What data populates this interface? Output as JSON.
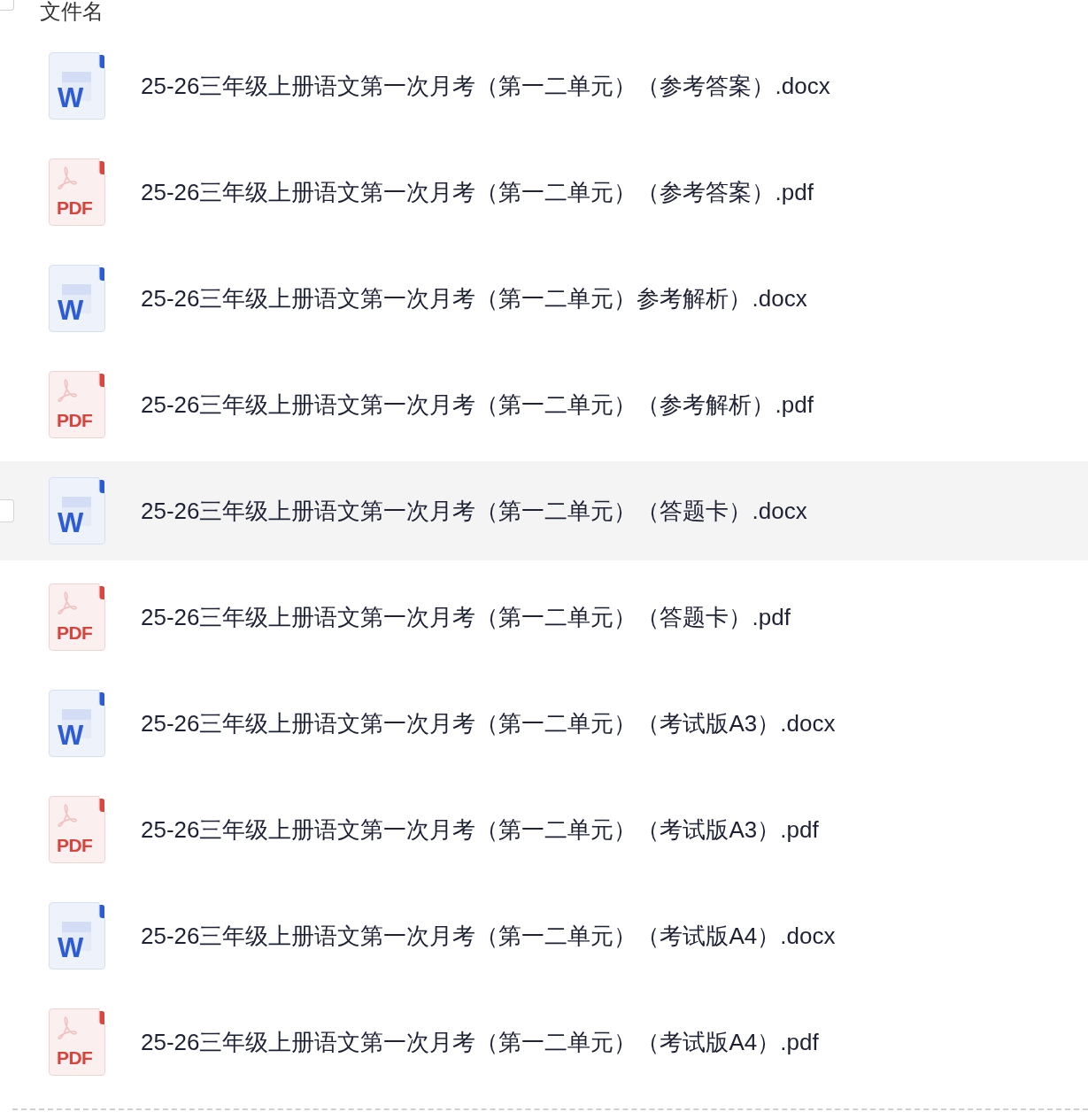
{
  "header": {
    "checkbox": {
      "checked": false
    },
    "label": "文件名"
  },
  "files": [
    {
      "kind": "docx",
      "type_label": "W",
      "name": "25-26三年级上册语文第一次月考（第一二单元）（参考答案）.docx",
      "highlighted": false,
      "checked": false
    },
    {
      "kind": "pdf",
      "type_label": "PDF",
      "name": "25-26三年级上册语文第一次月考（第一二单元）（参考答案）.pdf",
      "highlighted": false,
      "checked": false
    },
    {
      "kind": "docx",
      "type_label": "W",
      "name": "25-26三年级上册语文第一次月考（第一二单元）参考解析）.docx",
      "highlighted": false,
      "checked": false
    },
    {
      "kind": "pdf",
      "type_label": "PDF",
      "name": "25-26三年级上册语文第一次月考（第一二单元）（参考解析）.pdf",
      "highlighted": false,
      "checked": false
    },
    {
      "kind": "docx",
      "type_label": "W",
      "name": "25-26三年级上册语文第一次月考（第一二单元）（答题卡）.docx",
      "highlighted": true,
      "checked": false
    },
    {
      "kind": "pdf",
      "type_label": "PDF",
      "name": "25-26三年级上册语文第一次月考（第一二单元）（答题卡）.pdf",
      "highlighted": false,
      "checked": false
    },
    {
      "kind": "docx",
      "type_label": "W",
      "name": "25-26三年级上册语文第一次月考（第一二单元）（考试版A3）.docx",
      "highlighted": false,
      "checked": false
    },
    {
      "kind": "pdf",
      "type_label": "PDF",
      "name": "25-26三年级上册语文第一次月考（第一二单元）（考试版A3）.pdf",
      "highlighted": false,
      "checked": false
    },
    {
      "kind": "docx",
      "type_label": "W",
      "name": "25-26三年级上册语文第一次月考（第一二单元）（考试版A4）.docx",
      "highlighted": false,
      "checked": false
    },
    {
      "kind": "pdf",
      "type_label": "PDF",
      "name": "25-26三年级上册语文第一次月考（第一二单元）（考试版A4）.pdf",
      "highlighted": false,
      "checked": false
    }
  ]
}
